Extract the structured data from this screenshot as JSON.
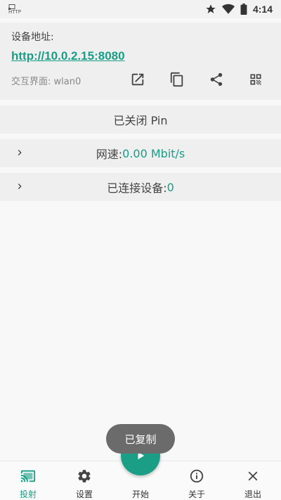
{
  "status_bar": {
    "badge": "HTTP",
    "time": "4:14"
  },
  "address": {
    "label": "设备地址:",
    "url": "http://10.0.2.15:8080",
    "interface": "交互界面: wlan0"
  },
  "pin_row": {
    "text": "已关闭 Pin"
  },
  "speed_row": {
    "label": "网速: ",
    "value": "0.00 Mbit/s"
  },
  "devices_row": {
    "label": "已连接设备: ",
    "value": "0"
  },
  "toast": {
    "text": "已复制"
  },
  "bottom_nav": {
    "items": [
      {
        "label": "投射",
        "icon": "cast-icon"
      },
      {
        "label": "设置",
        "icon": "settings-icon"
      },
      {
        "label": "开始",
        "icon": "play-icon"
      },
      {
        "label": "关于",
        "icon": "info-icon"
      },
      {
        "label": "退出",
        "icon": "close-icon"
      }
    ]
  },
  "colors": {
    "accent": "#179e86",
    "toast_bg": "#6b6b6b"
  }
}
